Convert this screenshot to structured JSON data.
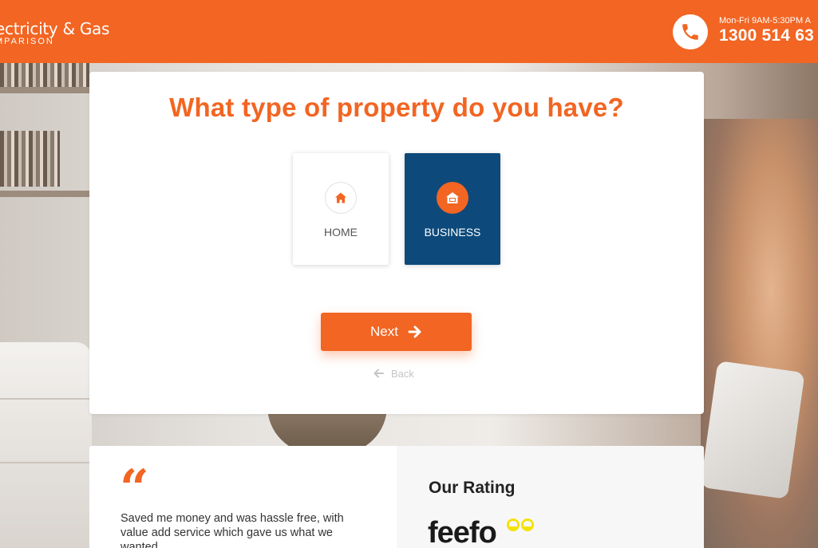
{
  "header": {
    "logo_line1": "ectricity & Gas",
    "logo_line2": "MPARISON",
    "phone_hours": "Mon-Fri 9AM-5:30PM A",
    "phone_number": "1300 514 63"
  },
  "form": {
    "question": "What type of property do you have?",
    "options": [
      {
        "label": "HOME",
        "icon": "house-icon",
        "selected": false
      },
      {
        "label": "BUSINESS",
        "icon": "building-icon",
        "selected": true
      }
    ],
    "next_label": "Next",
    "back_label": "Back"
  },
  "testimonial": {
    "quote_mark": "“",
    "text": "Saved me money and was hassle free, with value add service which gave us what we wanted"
  },
  "rating": {
    "title": "Our Rating",
    "brand": "feefo"
  },
  "colors": {
    "accent": "#f26522",
    "selected_option": "#0d4a7b",
    "feefo_yellow": "#f4e200"
  }
}
